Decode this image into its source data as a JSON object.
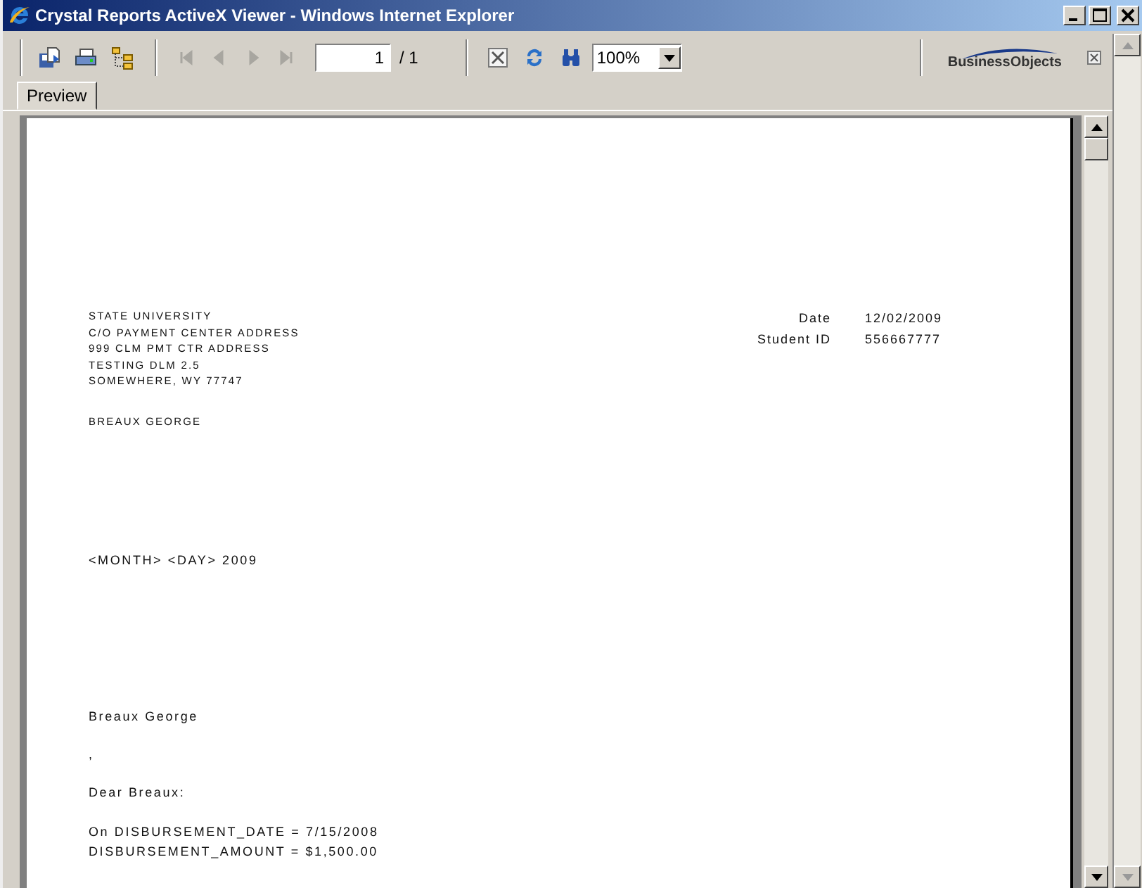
{
  "window": {
    "title": "Crystal Reports ActiveX Viewer - Windows Internet Explorer"
  },
  "toolbar": {
    "nav_buttons": [
      {
        "kind": "first",
        "disabled": true
      },
      {
        "kind": "previous",
        "disabled": true
      },
      {
        "kind": "next",
        "disabled": true
      },
      {
        "kind": "last",
        "disabled": true
      }
    ],
    "page_number": "1",
    "page_count": "/ 1",
    "zoom": "100%",
    "logo": "Business**Objects**"
  },
  "tabs": [
    {
      "label": "Preview",
      "selected": true
    }
  ],
  "report": {
    "address_lines": [
      "STATE UNIVERSITY",
      "C/O PAYMENT CENTER ADDRESS",
      "999 CLM PMT CTR ADDRESS",
      "TESTING DLM 2.5",
      "SOMEWHERE, WY 77747"
    ],
    "info": [
      {
        "label": "Date",
        "value": "12/02/2009"
      },
      {
        "label": "Student ID",
        "value": "556667777"
      }
    ],
    "recipient": "BREAUX GEORGE",
    "date_line": "<MONTH> <DAY> 2009",
    "name_line": "Breaux George",
    "comma_line": ",",
    "salutation": "Dear Breaux:",
    "body_lines": [
      "On DISBURSEMENT_DATE = 7/15/2008",
      "DISBURSEMENT_AMOUNT = $1,500.00"
    ]
  }
}
